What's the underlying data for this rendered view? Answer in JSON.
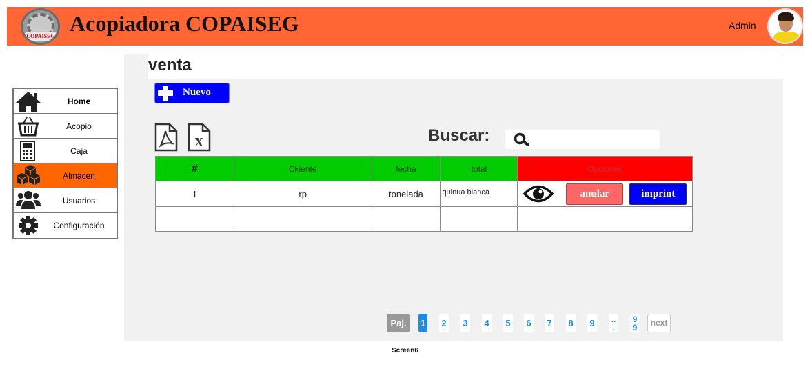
{
  "header": {
    "title": "Acopiadora COPAISEG",
    "logo_text": "COPAISEG",
    "user": "Admin"
  },
  "sidebar": {
    "items": [
      {
        "label": "Home",
        "icon": "home-icon"
      },
      {
        "label": "Acopio",
        "icon": "basket-icon"
      },
      {
        "label": "Caja",
        "icon": "calculator-icon"
      },
      {
        "label": "Almacen",
        "icon": "boxes-icon",
        "active": true
      },
      {
        "label": "Usuarios",
        "icon": "users-icon"
      },
      {
        "label": "Configuración",
        "icon": "gear-icon"
      }
    ]
  },
  "main": {
    "heading": "venta",
    "new_button": "Nuevo",
    "search_label": "Buscar:",
    "search_placeholder": ""
  },
  "table": {
    "columns": [
      "#",
      "Ckiente",
      "fecha",
      "total",
      "Opciones"
    ],
    "rows": [
      {
        "num": "1",
        "cliente": "rp",
        "fecha": "tonelada",
        "total": "quinua blanca"
      }
    ],
    "actions": {
      "anular": "anular",
      "imprint": "imprint"
    }
  },
  "pagination": {
    "prefix": "Paj.",
    "pages": [
      "1",
      "2",
      "3",
      "4",
      "5",
      "6",
      "7",
      "8",
      "9"
    ],
    "ellipsis_top": "..",
    "ellipsis_bottom": ".",
    "last_top": "9",
    "last_bottom": "9",
    "next": "next",
    "current": 1
  },
  "footer": {
    "caption": "Screen6"
  },
  "colors": {
    "header": "#ff6633",
    "active": "#ff6600",
    "primary": "#0000ff",
    "green": "#00cc00",
    "red": "#ff0000",
    "danger": "#ff6666"
  }
}
